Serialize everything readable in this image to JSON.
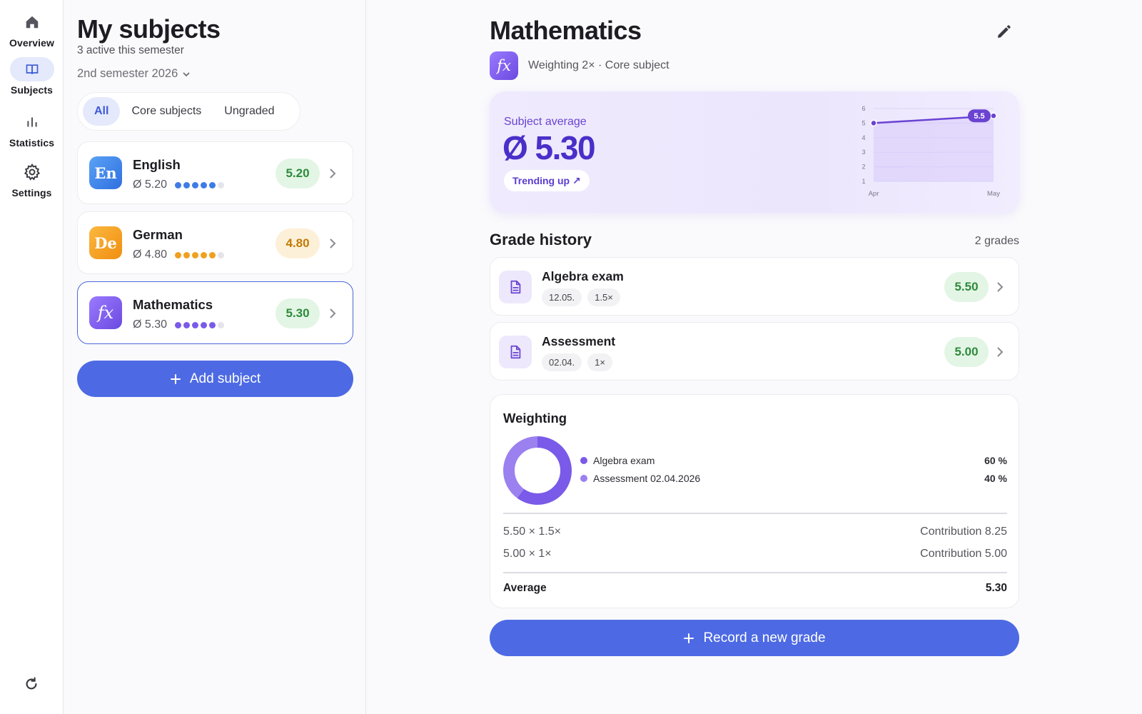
{
  "nav": {
    "items": [
      {
        "label": "Overview",
        "icon": "home-icon",
        "active": false
      },
      {
        "label": "Subjects",
        "icon": "book-icon",
        "active": true
      },
      {
        "label": "Statistics",
        "icon": "bar-chart-icon",
        "active": false
      },
      {
        "label": "Settings",
        "icon": "gear-icon",
        "active": false
      }
    ],
    "refresh_icon": "refresh-icon"
  },
  "subjects_panel": {
    "title": "My subjects",
    "subtitle": "3 active this semester",
    "semester": "2nd semester 2026",
    "filters": [
      "All",
      "Core subjects",
      "Ungraded"
    ],
    "active_filter": "All",
    "subjects": [
      {
        "badge": "En",
        "name": "English",
        "average": "Ø 5.20",
        "grade": "5.20",
        "filled_dots": 5,
        "total_dots": 6,
        "color": "#3f7be6",
        "grade_style": "green"
      },
      {
        "badge": "De",
        "name": "German",
        "average": "Ø 4.80",
        "grade": "4.80",
        "filled_dots": 5,
        "total_dots": 6,
        "color": "#f0a020",
        "grade_style": "orange"
      },
      {
        "badge": "fx",
        "name": "Mathematics",
        "average": "Ø 5.30",
        "grade": "5.30",
        "filled_dots": 5,
        "total_dots": 6,
        "color": "#7a5ae8",
        "grade_style": "green",
        "selected": true
      }
    ],
    "add_button": "Add subject"
  },
  "detail": {
    "title": "Mathematics",
    "badge": "fx",
    "meta": "Weighting 2× · Core subject",
    "average_card": {
      "label": "Subject average",
      "value": "Ø 5.30",
      "trend": "Trending up ↗"
    },
    "chart_data": {
      "type": "line",
      "categories": [
        "Apr",
        "May"
      ],
      "values": [
        5.0,
        5.5
      ],
      "y_ticks": [
        "1",
        "2",
        "3",
        "4",
        "5",
        "6"
      ],
      "ylim": [
        1,
        6
      ],
      "end_label": "5.5",
      "grid": true
    },
    "history": {
      "title": "Grade history",
      "count": "2 grades",
      "grades": [
        {
          "name": "Algebra exam",
          "date": "12.05.",
          "weight": "1.5×",
          "grade": "5.50"
        },
        {
          "name": "Assessment",
          "date": "02.04.",
          "weight": "1×",
          "grade": "5.00"
        }
      ]
    },
    "weighting": {
      "title": "Weighting",
      "legend": [
        {
          "label": "Algebra exam",
          "pct": "60 %",
          "share": 0.6,
          "color": "#7a5ae8"
        },
        {
          "label": "Assessment 02.04.2026",
          "pct": "40 %",
          "share": 0.4,
          "color": "#9b80f0"
        }
      ],
      "calc": [
        {
          "formula": "5.50 × 1.5×",
          "contribution": "Contribution 8.25"
        },
        {
          "formula": "5.00 × 1×",
          "contribution": "Contribution 5.00"
        }
      ],
      "average_label": "Average",
      "average_value": "5.30"
    },
    "record_button": "Record a new grade"
  },
  "colors": {
    "accent": "#4d6ae4",
    "purple": "#6a43d2",
    "grade_green_bg": "#e3f5e5",
    "grade_green_text": "#2e8a3b",
    "grade_orange_bg": "#fcf0d9",
    "grade_orange_text": "#c27a06"
  }
}
